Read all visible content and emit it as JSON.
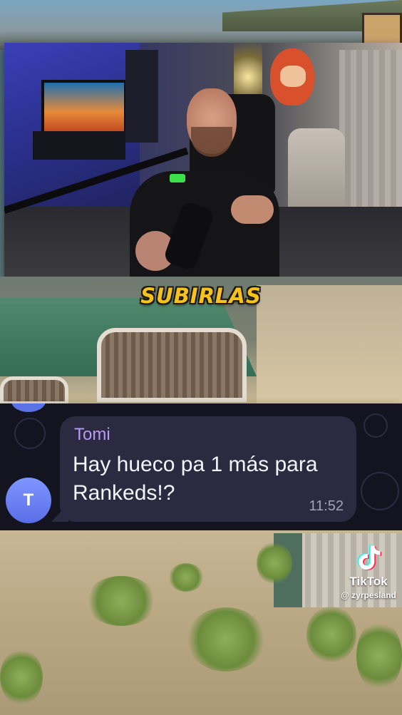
{
  "caption": {
    "text": "SUBIRLAS"
  },
  "chat": {
    "avatar_letter": "T",
    "sender": "Tomi",
    "message": "Hay hueco pa 1 más para Rankeds!?",
    "time": "11:52"
  },
  "watermark": {
    "brand": "TikTok",
    "handle": "@ zyrpesland"
  },
  "colors": {
    "caption": "#f7c21c",
    "sender": "#b99af7",
    "bubble": "#2b2a40",
    "avatar": "#6b80f2"
  },
  "icons": {
    "tiktok": "tiktok-logo-icon"
  }
}
